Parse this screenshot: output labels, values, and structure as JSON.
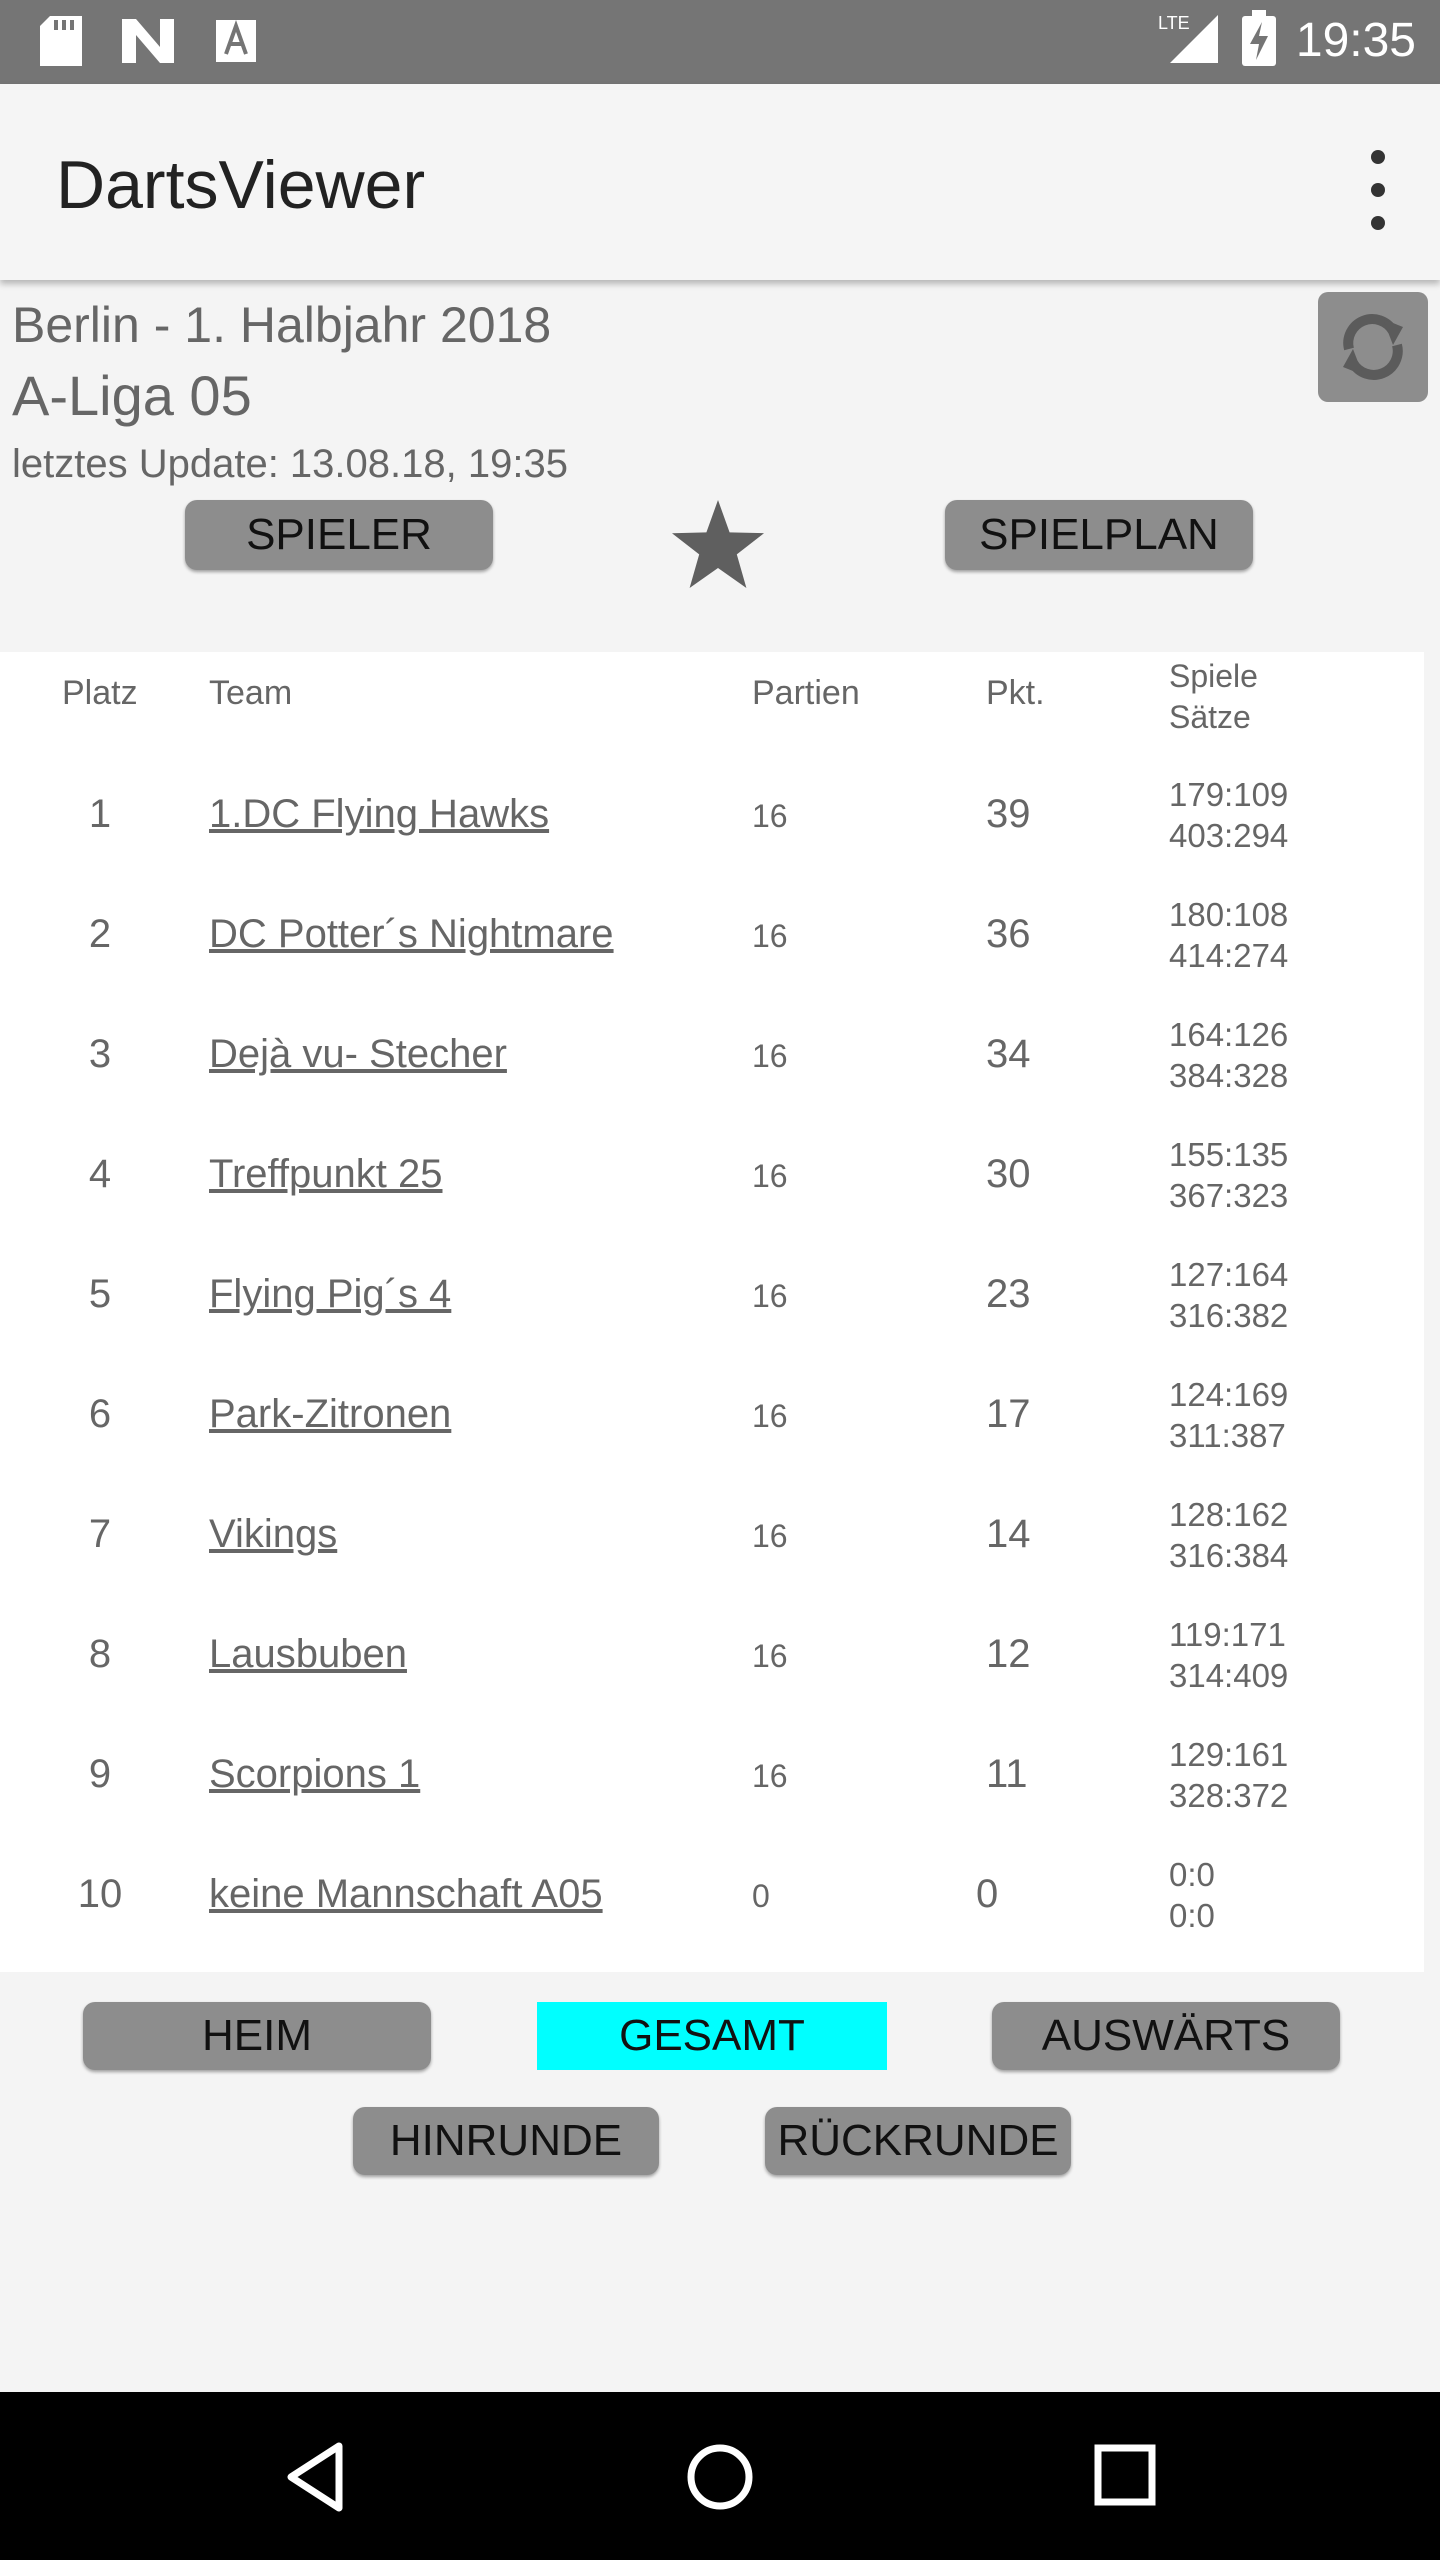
{
  "status_bar": {
    "time": "19:35",
    "left_icons": [
      "sd-card-icon",
      "n-logo-icon",
      "text-a-icon"
    ],
    "right_icons": [
      "lte-signal-icon",
      "battery-charging-icon"
    ],
    "lte_label": "LTE"
  },
  "app_bar": {
    "title": "DartsViewer",
    "menu_icon": "more-vert-icon"
  },
  "header": {
    "league": "Berlin - 1. Halbjahr 2018",
    "division": "A-Liga 05",
    "last_update": "letztes Update: 13.08.18, 19:35",
    "refresh_icon": "refresh-icon"
  },
  "top_buttons": {
    "players": "SPIELER",
    "schedule": "SPIELPLAN",
    "favorite_icon": "star-icon"
  },
  "table": {
    "headers": {
      "rank": "Platz",
      "team": "Team",
      "games": "Partien",
      "points": "Pkt.",
      "matches": "Spiele",
      "sets": "Sätze"
    },
    "rows": [
      {
        "rank": "1",
        "team": "1.DC Flying Hawks",
        "games": "16",
        "points": "39",
        "matches": "179:109",
        "sets": "403:294"
      },
      {
        "rank": "2",
        "team": "DC Potter´s Nightmare",
        "games": "16",
        "points": "36",
        "matches": "180:108",
        "sets": "414:274"
      },
      {
        "rank": "3",
        "team": "Dejà vu- Stecher",
        "games": "16",
        "points": "34",
        "matches": "164:126",
        "sets": "384:328"
      },
      {
        "rank": "4",
        "team": "Treffpunkt 25",
        "games": "16",
        "points": "30",
        "matches": "155:135",
        "sets": "367:323"
      },
      {
        "rank": "5",
        "team": "Flying Pig´s 4",
        "games": "16",
        "points": "23",
        "matches": "127:164",
        "sets": "316:382"
      },
      {
        "rank": "6",
        "team": "Park-Zitronen",
        "games": "16",
        "points": "17",
        "matches": "124:169",
        "sets": "311:387"
      },
      {
        "rank": "7",
        "team": "Vikings",
        "games": "16",
        "points": "14",
        "matches": "128:162",
        "sets": "316:384"
      },
      {
        "rank": "8",
        "team": "Lausbuben",
        "games": "16",
        "points": "12",
        "matches": "119:171",
        "sets": "314:409"
      },
      {
        "rank": "9",
        "team": "Scorpions 1",
        "games": "16",
        "points": "11",
        "matches": "129:161",
        "sets": "328:372"
      },
      {
        "rank": "10",
        "team": "keine Mannschaft A05",
        "games": "0",
        "points": "0",
        "matches": "0:0",
        "sets": "0:0"
      }
    ]
  },
  "filters": {
    "home": "HEIM",
    "total": "GESAMT",
    "away": "AUSWÄRTS",
    "first_half": "HINRUNDE",
    "second_half": "RÜCKRUNDE",
    "active": "GESAMT",
    "active_color": "#00ffff",
    "button_color": "#8d8d8d"
  },
  "nav_bar": {
    "icons": [
      "back-icon",
      "home-icon",
      "recents-icon"
    ]
  }
}
